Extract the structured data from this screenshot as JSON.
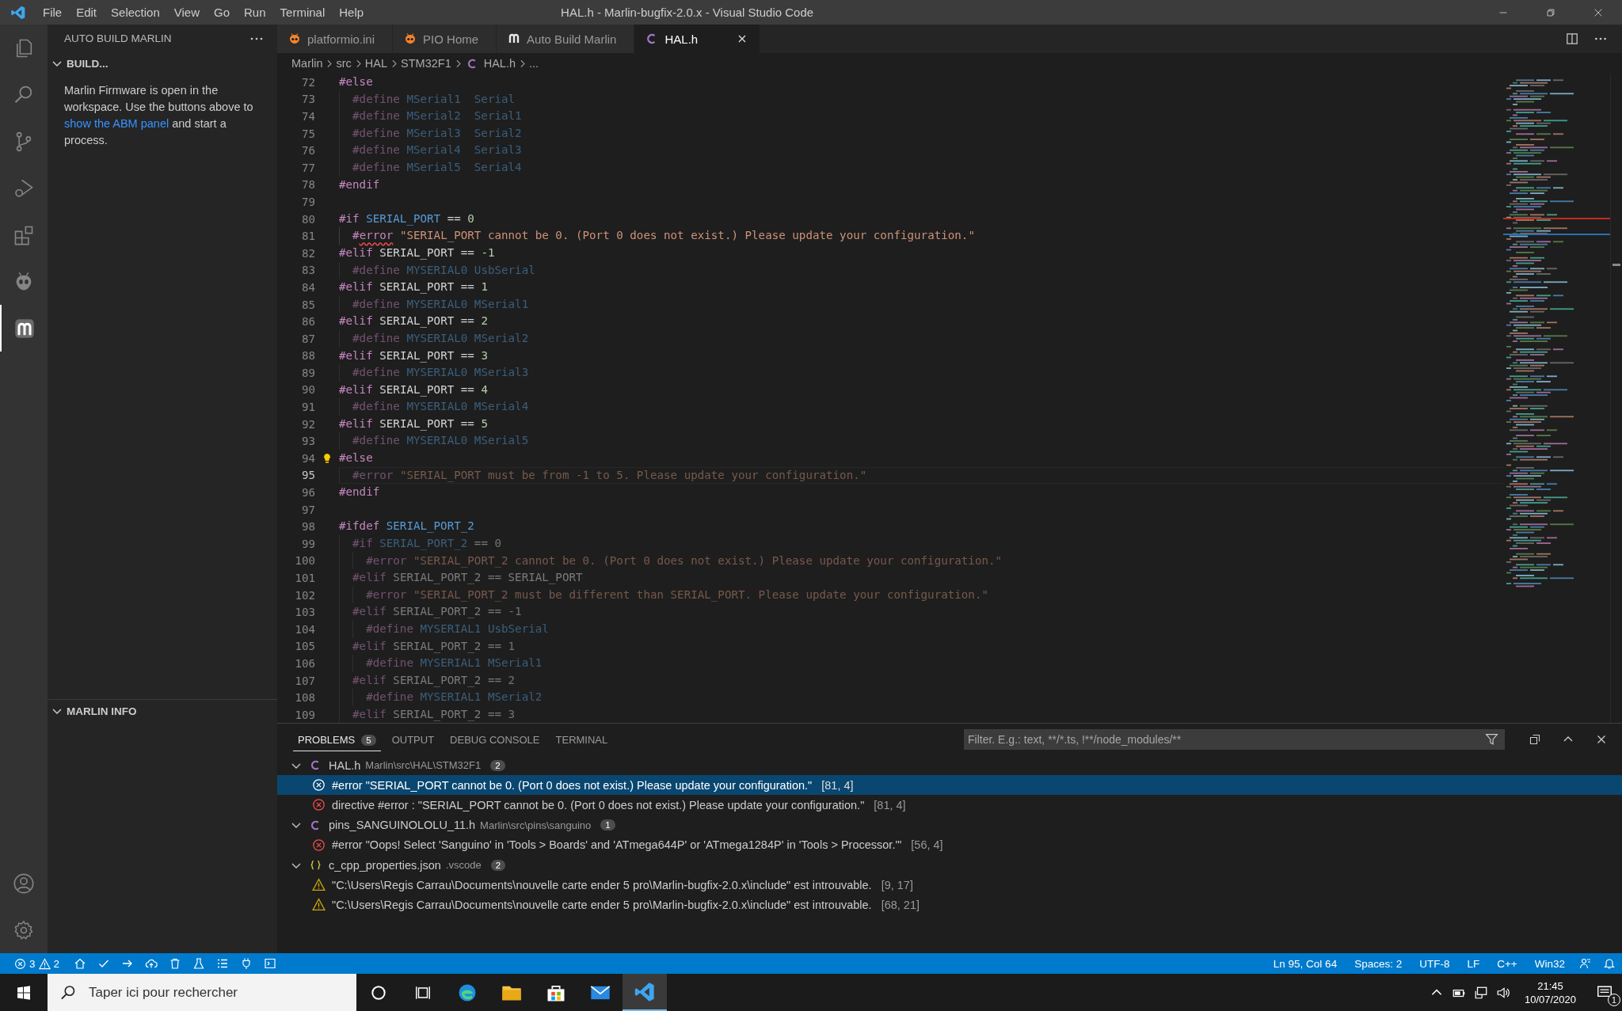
{
  "title_bar": {
    "menus": [
      "File",
      "Edit",
      "Selection",
      "View",
      "Go",
      "Run",
      "Terminal",
      "Help"
    ],
    "title": "HAL.h - Marlin-bugfix-2.0.x - Visual Studio Code"
  },
  "activity_bar": {
    "items": [
      {
        "selected": false
      },
      {
        "selected": false
      },
      {
        "selected": false
      },
      {
        "selected": false
      },
      {
        "selected": false
      },
      {
        "selected": false
      },
      {
        "selected": true
      }
    ]
  },
  "sidebar": {
    "title": "AUTO BUILD MARLIN",
    "sections": [
      {
        "title": "BUILD...",
        "expanded": true,
        "text_before": "Marlin Firmware is open in the workspace. Use the buttons above to ",
        "link": "show the ABM panel",
        "text_after": " and start a process."
      },
      {
        "title": "MARLIN INFO",
        "expanded": true
      }
    ]
  },
  "tabs": [
    {
      "kind": "pio",
      "label": "platformio.ini",
      "selected": false
    },
    {
      "kind": "pio",
      "label": "PIO Home",
      "selected": false
    },
    {
      "kind": "marlin",
      "label": "Auto Build Marlin",
      "selected": false
    },
    {
      "kind": "c",
      "label": "HAL.h",
      "selected": true
    }
  ],
  "breadcrumb": [
    {
      "kind": "folder",
      "label": "Marlin"
    },
    {
      "kind": "folder",
      "label": "src"
    },
    {
      "kind": "folder",
      "label": "HAL"
    },
    {
      "kind": "folder",
      "label": "STM32F1"
    },
    {
      "kind": "c",
      "label": "HAL.h"
    },
    {
      "kind": "more",
      "label": "..."
    }
  ],
  "editor": {
    "lines": [
      {
        "number": "72",
        "inactive": false,
        "current": false,
        "tokens": [
          {
            "kind": "kw",
            "text": "#else"
          }
        ]
      },
      {
        "number": "73",
        "inactive": true,
        "current": false,
        "tokens": [
          {
            "kind": "kw",
            "text": "  #define"
          },
          {
            "kind": "macro",
            "text": " MSerial1"
          },
          {
            "kind": "macro",
            "text": "  Serial"
          }
        ]
      },
      {
        "number": "74",
        "inactive": true,
        "current": false,
        "tokens": [
          {
            "kind": "kw",
            "text": "  #define"
          },
          {
            "kind": "macro",
            "text": " MSerial2"
          },
          {
            "kind": "macro",
            "text": "  Serial1"
          }
        ]
      },
      {
        "number": "75",
        "inactive": true,
        "current": false,
        "tokens": [
          {
            "kind": "kw",
            "text": "  #define"
          },
          {
            "kind": "macro",
            "text": " MSerial3"
          },
          {
            "kind": "macro",
            "text": "  Serial2"
          }
        ]
      },
      {
        "number": "76",
        "inactive": true,
        "current": false,
        "tokens": [
          {
            "kind": "kw",
            "text": "  #define"
          },
          {
            "kind": "macro",
            "text": " MSerial4"
          },
          {
            "kind": "macro",
            "text": "  Serial3"
          }
        ]
      },
      {
        "number": "77",
        "inactive": true,
        "current": false,
        "tokens": [
          {
            "kind": "kw",
            "text": "  #define"
          },
          {
            "kind": "macro",
            "text": " MSerial5"
          },
          {
            "kind": "macro",
            "text": "  Serial4"
          }
        ]
      },
      {
        "number": "78",
        "inactive": false,
        "current": false,
        "tokens": [
          {
            "kind": "kw",
            "text": "#endif"
          }
        ]
      },
      {
        "number": "79",
        "current": false
      },
      {
        "number": "80",
        "inactive": false,
        "current": false,
        "tokens": [
          {
            "kind": "kw",
            "text": "#if"
          },
          {
            "kind": "macro",
            "text": " SERIAL_PORT"
          },
          {
            "kind": "plain",
            "text": " =="
          },
          {
            "kind": "num",
            "text": " 0"
          }
        ]
      },
      {
        "number": "81",
        "inactive": false,
        "current": false,
        "tokens": [
          {
            "kind": "kw",
            "text": "  #"
          },
          {
            "kind": "kwbad",
            "text": "error"
          },
          {
            "kind": "str",
            "text": " \"SERIAL_PORT cannot be 0. (Port 0 does not exist.) Please update your configuration.\""
          }
        ]
      },
      {
        "number": "82",
        "inactive": false,
        "current": false,
        "tokens": [
          {
            "kind": "kw",
            "text": "#elif"
          },
          {
            "kind": "plain",
            "text": " SERIAL_PORT =="
          },
          {
            "kind": "num",
            "text": " -1"
          }
        ]
      },
      {
        "number": "83",
        "inactive": true,
        "current": false,
        "tokens": [
          {
            "kind": "kw",
            "text": "  #define"
          },
          {
            "kind": "macro",
            "text": " MYSERIAL0"
          },
          {
            "kind": "macro",
            "text": " UsbSerial"
          }
        ]
      },
      {
        "number": "84",
        "inactive": false,
        "current": false,
        "tokens": [
          {
            "kind": "kw",
            "text": "#elif"
          },
          {
            "kind": "plain",
            "text": " SERIAL_PORT =="
          },
          {
            "kind": "num",
            "text": " 1"
          }
        ]
      },
      {
        "number": "85",
        "inactive": true,
        "current": false,
        "tokens": [
          {
            "kind": "kw",
            "text": "  #define"
          },
          {
            "kind": "macro",
            "text": " MYSERIAL0"
          },
          {
            "kind": "macro",
            "text": " MSerial1"
          }
        ]
      },
      {
        "number": "86",
        "inactive": false,
        "current": false,
        "tokens": [
          {
            "kind": "kw",
            "text": "#elif"
          },
          {
            "kind": "plain",
            "text": " SERIAL_PORT =="
          },
          {
            "kind": "num",
            "text": " 2"
          }
        ]
      },
      {
        "number": "87",
        "inactive": true,
        "current": false,
        "tokens": [
          {
            "kind": "kw",
            "text": "  #define"
          },
          {
            "kind": "macro",
            "text": " MYSERIAL0"
          },
          {
            "kind": "macro",
            "text": " MSerial2"
          }
        ]
      },
      {
        "number": "88",
        "inactive": false,
        "current": false,
        "tokens": [
          {
            "kind": "kw",
            "text": "#elif"
          },
          {
            "kind": "plain",
            "text": " SERIAL_PORT =="
          },
          {
            "kind": "num",
            "text": " 3"
          }
        ]
      },
      {
        "number": "89",
        "inactive": true,
        "current": false,
        "tokens": [
          {
            "kind": "kw",
            "text": "  #define"
          },
          {
            "kind": "macro",
            "text": " MYSERIAL0"
          },
          {
            "kind": "macro",
            "text": " MSerial3"
          }
        ]
      },
      {
        "number": "90",
        "inactive": false,
        "current": false,
        "tokens": [
          {
            "kind": "kw",
            "text": "#elif"
          },
          {
            "kind": "plain",
            "text": " SERIAL_PORT =="
          },
          {
            "kind": "num",
            "text": " 4"
          }
        ]
      },
      {
        "number": "91",
        "inactive": true,
        "current": false,
        "tokens": [
          {
            "kind": "kw",
            "text": "  #define"
          },
          {
            "kind": "macro",
            "text": " MYSERIAL0"
          },
          {
            "kind": "macro",
            "text": " MSerial4"
          }
        ]
      },
      {
        "number": "92",
        "inactive": false,
        "current": false,
        "tokens": [
          {
            "kind": "kw",
            "text": "#elif"
          },
          {
            "kind": "plain",
            "text": " SERIAL_PORT =="
          },
          {
            "kind": "num",
            "text": " 5"
          }
        ]
      },
      {
        "number": "93",
        "inactive": true,
        "current": false,
        "tokens": [
          {
            "kind": "kw",
            "text": "  #define"
          },
          {
            "kind": "macro",
            "text": " MYSERIAL0"
          },
          {
            "kind": "macro",
            "text": " MSerial5"
          }
        ]
      },
      {
        "number": "94",
        "inactive": false,
        "current": false,
        "tokens": [
          {
            "kind": "kw",
            "text": "#else"
          }
        ]
      },
      {
        "number": "95",
        "inactive": true,
        "current": true,
        "tokens": [
          {
            "kind": "kw",
            "text": "  #error"
          },
          {
            "kind": "str",
            "text": " \"SERIAL_PORT must be from -1 to 5. Please update your configuration.\""
          }
        ]
      },
      {
        "number": "96",
        "inactive": false,
        "current": false,
        "tokens": [
          {
            "kind": "kw",
            "text": "#endif"
          }
        ]
      },
      {
        "number": "97",
        "current": false
      },
      {
        "number": "98",
        "inactive": false,
        "current": false,
        "tokens": [
          {
            "kind": "kw",
            "text": "#ifdef"
          },
          {
            "kind": "macro",
            "text": " SERIAL_PORT_2"
          }
        ]
      },
      {
        "number": "99",
        "inactive": true,
        "current": false,
        "tokens": [
          {
            "kind": "kw",
            "text": "  #if"
          },
          {
            "kind": "macro",
            "text": " SERIAL_PORT_2"
          },
          {
            "kind": "plain",
            "text": " =="
          },
          {
            "kind": "num",
            "text": " 0"
          }
        ]
      },
      {
        "number": "100",
        "inactive": true,
        "current": false,
        "tokens": [
          {
            "kind": "kw",
            "text": "    #error"
          },
          {
            "kind": "str",
            "text": " \"SERIAL_PORT_2 cannot be 0. (Port 0 does not exist.) Please update your configuration.\""
          }
        ]
      },
      {
        "number": "101",
        "inactive": true,
        "current": false,
        "tokens": [
          {
            "kind": "kw",
            "text": "  #elif"
          },
          {
            "kind": "plain",
            "text": " SERIAL_PORT_2 == SERIAL_PORT"
          }
        ]
      },
      {
        "number": "102",
        "inactive": true,
        "current": false,
        "tokens": [
          {
            "kind": "kw",
            "text": "    #error"
          },
          {
            "kind": "str",
            "text": " \"SERIAL_PORT_2 must be different than SERIAL_PORT. Please update your configuration.\""
          }
        ]
      },
      {
        "number": "103",
        "inactive": true,
        "current": false,
        "tokens": [
          {
            "kind": "kw",
            "text": "  #elif"
          },
          {
            "kind": "plain",
            "text": " SERIAL_PORT_2 =="
          },
          {
            "kind": "num",
            "text": " -1"
          }
        ]
      },
      {
        "number": "104",
        "inactive": true,
        "current": false,
        "tokens": [
          {
            "kind": "kw",
            "text": "    #define"
          },
          {
            "kind": "macro",
            "text": " MYSERIAL1"
          },
          {
            "kind": "macro",
            "text": " UsbSerial"
          }
        ]
      },
      {
        "number": "105",
        "inactive": true,
        "current": false,
        "tokens": [
          {
            "kind": "kw",
            "text": "  #elif"
          },
          {
            "kind": "plain",
            "text": " SERIAL_PORT_2 =="
          },
          {
            "kind": "num",
            "text": " 1"
          }
        ]
      },
      {
        "number": "106",
        "inactive": true,
        "current": false,
        "tokens": [
          {
            "kind": "kw",
            "text": "    #define"
          },
          {
            "kind": "macro",
            "text": " MYSERIAL1"
          },
          {
            "kind": "macro",
            "text": " MSerial1"
          }
        ]
      },
      {
        "number": "107",
        "inactive": true,
        "current": false,
        "tokens": [
          {
            "kind": "kw",
            "text": "  #elif"
          },
          {
            "kind": "plain",
            "text": " SERIAL_PORT_2 =="
          },
          {
            "kind": "num",
            "text": " 2"
          }
        ]
      },
      {
        "number": "108",
        "inactive": true,
        "current": false,
        "tokens": [
          {
            "kind": "kw",
            "text": "    #define"
          },
          {
            "kind": "macro",
            "text": " MYSERIAL1"
          },
          {
            "kind": "macro",
            "text": " MSerial2"
          }
        ]
      },
      {
        "number": "109",
        "inactive": true,
        "current": false,
        "tokens": [
          {
            "kind": "kw",
            "text": "  #elif"
          },
          {
            "kind": "plain",
            "text": " SERIAL_PORT_2 =="
          },
          {
            "kind": "num",
            "text": " 3"
          }
        ]
      }
    ]
  },
  "panel": {
    "tabs": [
      {
        "label": "PROBLEMS",
        "badge": "5",
        "selected": true
      },
      {
        "label": "OUTPUT",
        "selected": false
      },
      {
        "label": "DEBUG CONSOLE",
        "selected": false
      },
      {
        "label": "TERMINAL",
        "selected": false
      }
    ],
    "filter": {
      "placeholder": "Filter. E.g.: text, **/*.ts, !**/node_modules/**"
    },
    "groups": [
      {
        "kind": "c",
        "file": "HAL.h",
        "path": "Marlin\\src\\HAL\\STM32F1",
        "count": "2",
        "expanded": true,
        "problems": [
          {
            "kind": "error",
            "message": "#error \"SERIAL_PORT cannot be 0. (Port 0 does not exist.) Please update your configuration.\"",
            "location": "[81, 4]",
            "selected": true
          },
          {
            "kind": "error",
            "message": "directive #error : \"SERIAL_PORT cannot be 0. (Port 0 does not exist.) Please update your configuration.\"",
            "location": "[81, 4]",
            "selected": false
          }
        ]
      },
      {
        "kind": "c",
        "file": "pins_SANGUINOLOLU_11.h",
        "path": "Marlin\\src\\pins\\sanguino",
        "count": "1",
        "expanded": true,
        "problems": [
          {
            "kind": "error",
            "message": "#error \"Oops! Select 'Sanguino' in 'Tools > Boards' and 'ATmega644P' or 'ATmega1284P' in 'Tools > Processor.'\"",
            "location": "[56, 4]",
            "selected": false
          }
        ]
      },
      {
        "kind": "json",
        "file": "c_cpp_properties.json",
        "path": ".vscode",
        "count": "2",
        "expanded": true,
        "problems": [
          {
            "kind": "warning",
            "message": "\"C:\\Users\\Regis Carrau\\Documents\\nouvelle carte ender 5 pro\\Marlin-bugfix-2.0.x\\include\" est introuvable.",
            "location": "[9, 17]",
            "selected": false
          },
          {
            "kind": "warning",
            "message": "\"C:\\Users\\Regis Carrau\\Documents\\nouvelle carte ender 5 pro\\Marlin-bugfix-2.0.x\\include\" est introuvable.",
            "location": "[68, 21]",
            "selected": false
          }
        ]
      }
    ]
  },
  "status_bar": {
    "errors": "3",
    "warnings": "2",
    "right": [
      "Ln 95, Col 64",
      "Spaces: 2",
      "UTF-8",
      "LF",
      "C++",
      "Win32"
    ]
  },
  "taskbar": {
    "search": {
      "placeholder": "Taper ici pour rechercher"
    },
    "apps": [
      {
        "selected": false
      },
      {
        "selected": false
      },
      {
        "selected": false
      },
      {
        "selected": false
      },
      {
        "selected": true
      }
    ],
    "time": "21:45",
    "date": "10/07/2020",
    "notifications": "1"
  }
}
